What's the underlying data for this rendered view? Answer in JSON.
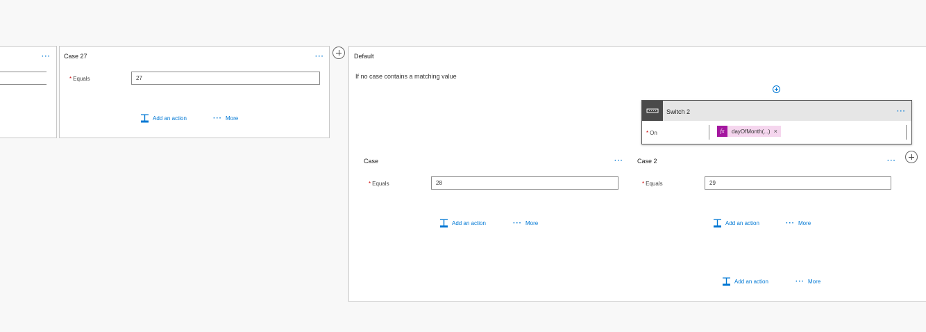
{
  "left_card": {
    "more_label": "···"
  },
  "case27": {
    "title": "Case 27",
    "more_label": "···",
    "equals_label": "Equals",
    "required_mark": "*",
    "equals_value": "27",
    "add_action": "Add an action",
    "more": "More"
  },
  "default": {
    "title": "Default",
    "description": "If no case contains a matching value",
    "add_action": "Add an action",
    "more": "More"
  },
  "switch2": {
    "title": "Switch 2",
    "more_label": "···",
    "on_label": "On",
    "required_mark": "*",
    "token_label": "dayOfMonth(...)",
    "token_icon": "fx",
    "token_remove": "×",
    "colors": {
      "header_bg": "#e6e6e6",
      "icon_bg": "#4a4a4a",
      "token_bg": "#f5d6ee",
      "token_icon_bg": "#a4169f"
    }
  },
  "case": {
    "title": "Case",
    "more_label": "···",
    "equals_label": "Equals",
    "required_mark": "*",
    "equals_value": "28",
    "add_action": "Add an action",
    "more": "More"
  },
  "case2": {
    "title": "Case 2",
    "more_label": "···",
    "equals_label": "Equals",
    "required_mark": "*",
    "equals_value": "29",
    "add_action": "Add an action",
    "more": "More"
  },
  "colors": {
    "accent": "#0078d4",
    "required": "#cc0000"
  }
}
